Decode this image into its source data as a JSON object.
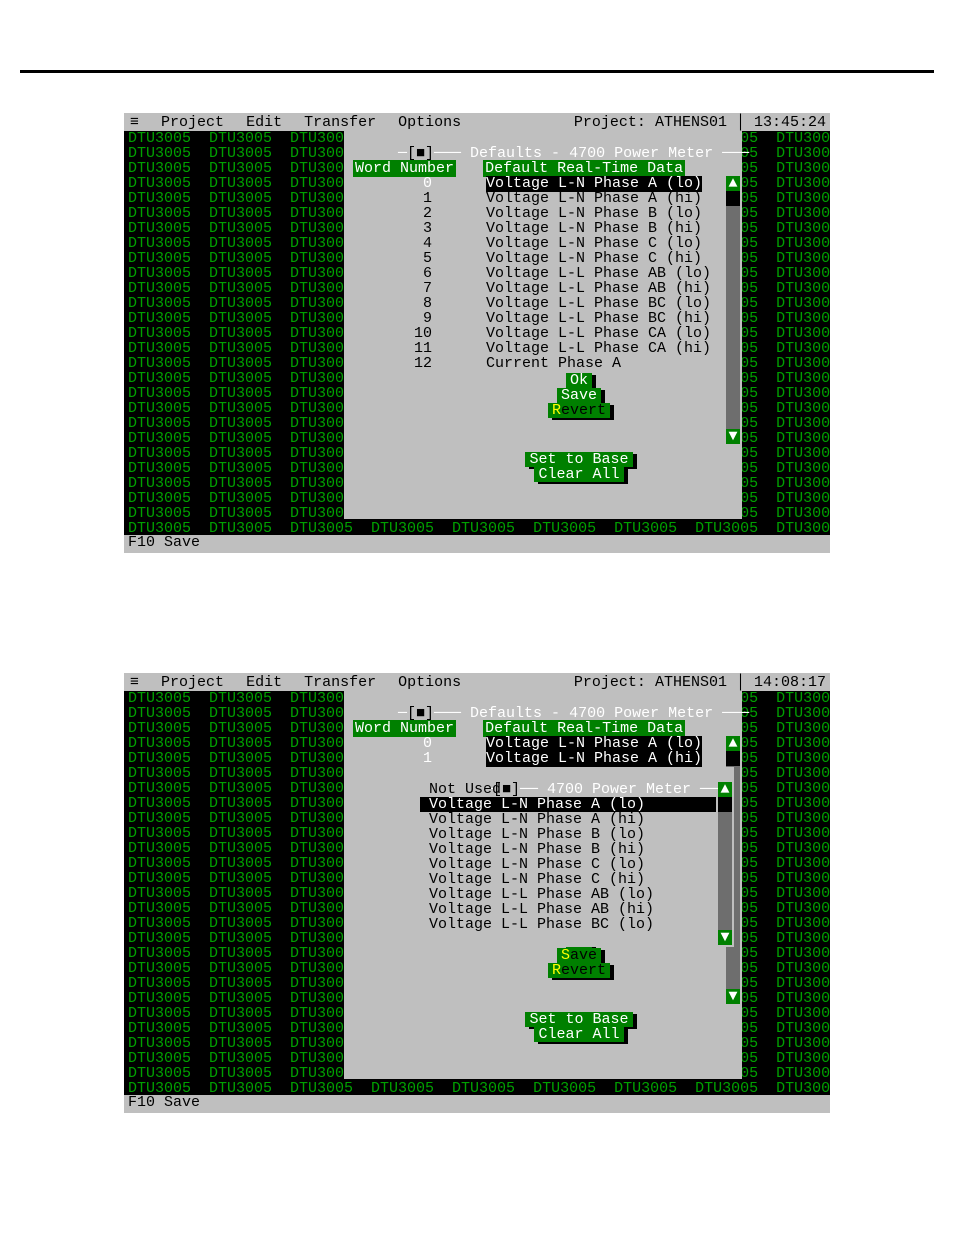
{
  "menubar": {
    "sys": "≡",
    "items": [
      "Project",
      "Edit",
      "Transfer",
      "Options"
    ],
    "project_label": "Project:",
    "project_name": "ATHENS01"
  },
  "times": {
    "shot1": "13:45:24",
    "shot2": "14:08:17"
  },
  "bg_token": "DTU3005",
  "statusbar": "F10 Save",
  "dialog": {
    "close_box": "[■]",
    "title": "Defaults - 4700 Power Meter",
    "col1": "Word Number",
    "col2": "Default Real-Time Data"
  },
  "rows": [
    {
      "n": "0",
      "d": "Voltage L-N Phase A (lo)",
      "sel": true
    },
    {
      "n": "1",
      "d": "Voltage L-N Phase A (hi)"
    },
    {
      "n": "2",
      "d": "Voltage L-N Phase B (lo)"
    },
    {
      "n": "3",
      "d": "Voltage L-N Phase B (hi)"
    },
    {
      "n": "4",
      "d": "Voltage L-N Phase C (lo)"
    },
    {
      "n": "5",
      "d": "Voltage L-N Phase C (hi)"
    },
    {
      "n": "6",
      "d": "Voltage L-L Phase AB (lo)"
    },
    {
      "n": "7",
      "d": "Voltage L-L Phase AB (hi)"
    },
    {
      "n": "8",
      "d": "Voltage L-L Phase BC (lo)"
    },
    {
      "n": "9",
      "d": "Voltage L-L Phase BC (hi)"
    },
    {
      "n": "10",
      "d": "Voltage L-L Phase CA (lo)"
    },
    {
      "n": "11",
      "d": "Voltage L-L Phase CA (hi)"
    },
    {
      "n": "12",
      "d": "Current Phase A"
    }
  ],
  "rows2": [
    {
      "n": "0",
      "d": "Voltage L-N Phase A (lo)",
      "sel": true
    },
    {
      "n": "1",
      "d": "Voltage L-N Phase A (hi)",
      "sel": true
    }
  ],
  "buttons": {
    "ok": {
      "pre": "O",
      "hot": "k",
      "post": ""
    },
    "save": {
      "pre": "",
      "hot": "S",
      "post": "ave"
    },
    "revert": {
      "pre": "",
      "hot": "R",
      "post": "evert"
    },
    "setbase": {
      "pre": "Set to ",
      "hot": "B",
      "post": "ase"
    },
    "clearall": {
      "pre": "Clear ",
      "hot": "A",
      "post": "ll"
    }
  },
  "inner": {
    "title": "4700 Power Meter",
    "items": [
      {
        "t": "Not Used"
      },
      {
        "t": "Voltage L-N Phase A (lo)",
        "sel": true
      },
      {
        "t": "Voltage L-N Phase A (hi)"
      },
      {
        "t": "Voltage L-N Phase B (lo)"
      },
      {
        "t": "Voltage L-N Phase B (hi)"
      },
      {
        "t": "Voltage L-N Phase C (lo)"
      },
      {
        "t": "Voltage L-N Phase C (hi)"
      },
      {
        "t": "Voltage L-L Phase AB (lo)"
      },
      {
        "t": "Voltage L-L Phase AB (hi)"
      },
      {
        "t": "Voltage L-L Phase BC (lo)"
      }
    ]
  },
  "scroll_glyph_up": "▲",
  "scroll_glyph_dn": "▼"
}
